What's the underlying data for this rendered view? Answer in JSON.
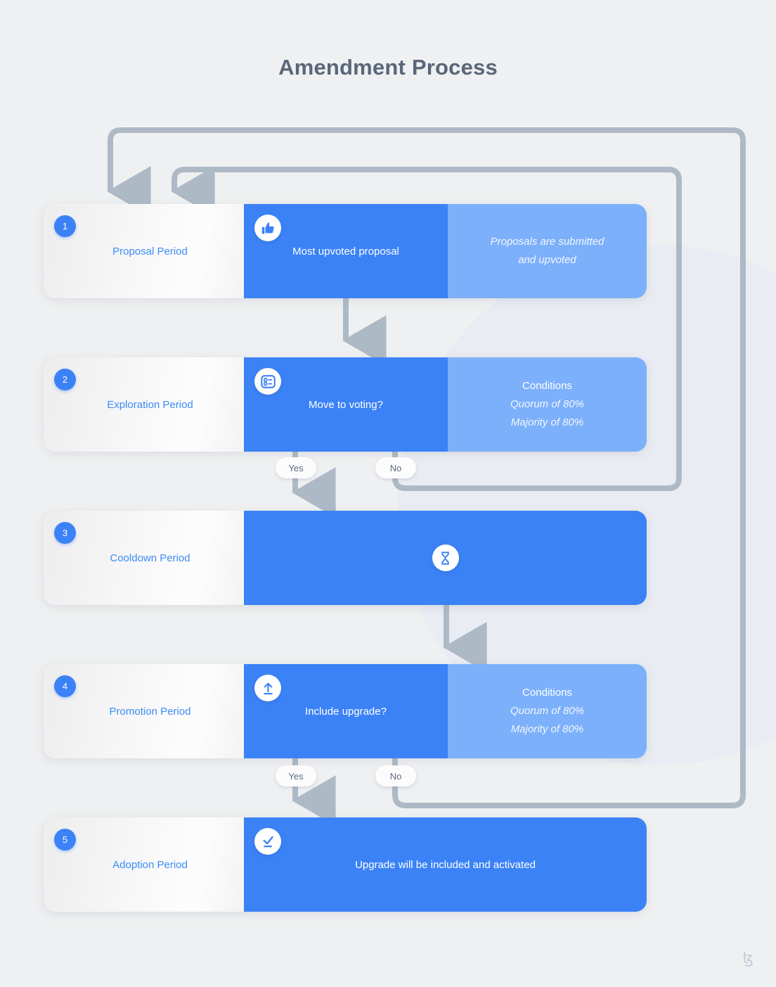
{
  "page": {
    "title": "Amendment Process",
    "watermark": "ꜩ"
  },
  "colors": {
    "background": "#eff0f1",
    "title_text": "#5a6679",
    "accent_blue": "#3b82f6",
    "light_blue": "#7cb0fb",
    "label_text": "#3b8cf7",
    "connector_gray": "#aeb9c6",
    "pill_text": "#5d6b80"
  },
  "steps": [
    {
      "number": "1",
      "label": "Proposal Period",
      "icon": "thumbs-up-icon",
      "main_text": "Most upvoted proposal",
      "side": {
        "kind": "description",
        "lines": [
          "Proposals are submitted",
          "and upvoted"
        ]
      }
    },
    {
      "number": "2",
      "label": "Exploration Period",
      "icon": "ballot-icon",
      "main_text": "Move to voting?",
      "side": {
        "kind": "conditions",
        "title": "Conditions",
        "lines": [
          "Quorum of 80%",
          "Majority of 80%"
        ]
      }
    },
    {
      "number": "3",
      "label": "Cooldown Period",
      "icon": "hourglass-icon",
      "main_text": "",
      "side": null
    },
    {
      "number": "4",
      "label": "Promotion Period",
      "icon": "upload-icon",
      "main_text": "Include upgrade?",
      "side": {
        "kind": "conditions",
        "title": "Conditions",
        "lines": [
          "Quorum of 80%",
          "Majority of 80%"
        ]
      }
    },
    {
      "number": "5",
      "label": "Adoption Period",
      "icon": "check-circle-icon",
      "main_text": "Upgrade will be included and activated",
      "side": null
    }
  ],
  "decisions": [
    {
      "from_step": "2",
      "yes": "Yes",
      "no": "No"
    },
    {
      "from_step": "4",
      "yes": "Yes",
      "no": "No"
    }
  ],
  "flow": {
    "forward_arrows": [
      "Proposal Period -> Exploration Period",
      "Exploration Period (Yes) -> Cooldown Period",
      "Cooldown Period -> Promotion Period",
      "Promotion Period (Yes) -> Adoption Period"
    ],
    "feedback_arrows": [
      "Exploration Period (No) -> Proposal Period",
      "Promotion Period (No) -> Proposal Period"
    ]
  }
}
